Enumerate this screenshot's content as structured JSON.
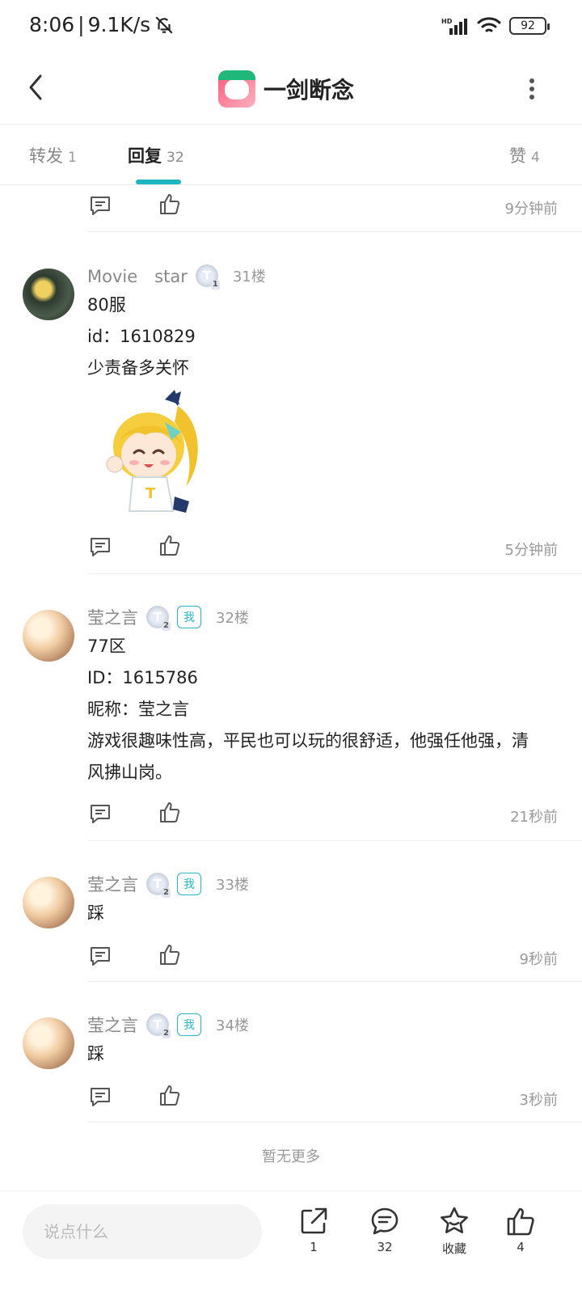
{
  "status_bar": {
    "time": "8:06",
    "speed": "9.1K/s",
    "battery": "92"
  },
  "header": {
    "title": "一剑断念"
  },
  "tabs": [
    {
      "label": "转发",
      "count": "1"
    },
    {
      "label": "回复",
      "count": "32"
    },
    {
      "label": "赞",
      "count": "4"
    }
  ],
  "top_item": {
    "time": "9分钟前"
  },
  "posts": [
    {
      "username": "Movie　star",
      "level": "1",
      "floor": "31楼",
      "lines": [
        "80服",
        "id：1610829",
        "少责备多关怀"
      ],
      "time": "5分钟前",
      "has_sticker": true
    },
    {
      "username": "莹之言",
      "level": "2",
      "me_badge": "我",
      "floor": "32楼",
      "lines": [
        "77区",
        "ID：1615786",
        "昵称：莹之言",
        "游戏很趣味性高，平民也可以玩的很舒适，他强任他强，清",
        "风拂山岗。"
      ],
      "time": "21秒前"
    },
    {
      "username": "莹之言",
      "level": "2",
      "me_badge": "我",
      "floor": "33楼",
      "lines": [
        "踩"
      ],
      "time": "9秒前"
    },
    {
      "username": "莹之言",
      "level": "2",
      "me_badge": "我",
      "floor": "34楼",
      "lines": [
        "踩"
      ],
      "time": "3秒前"
    }
  ],
  "end_text": "暂无更多",
  "bottom_bar": {
    "input_placeholder": "说点什么",
    "share_count": "1",
    "comment_count": "32",
    "favorite_label": "收藏",
    "like_count": "4"
  },
  "colors": {
    "accent": "#1cb5c0",
    "me_badge": "#2bb7c2"
  }
}
